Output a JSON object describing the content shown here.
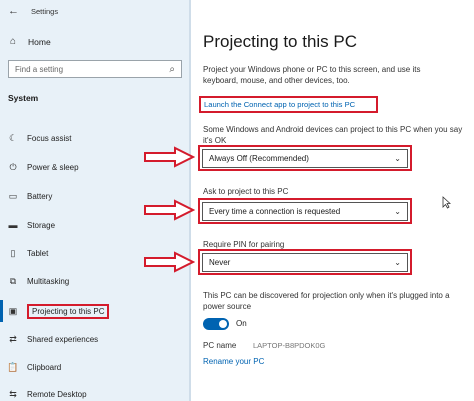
{
  "window": {
    "title": "Settings"
  },
  "sidebar": {
    "home": {
      "label": "Home",
      "icon": "home-icon"
    },
    "search": {
      "placeholder": "Find a setting",
      "icon": "search-icon"
    },
    "section": "System",
    "items": [
      {
        "label": "Focus assist",
        "icon": "moon-icon"
      },
      {
        "label": "Power & sleep",
        "icon": "power-icon"
      },
      {
        "label": "Battery",
        "icon": "battery-icon"
      },
      {
        "label": "Storage",
        "icon": "storage-icon"
      },
      {
        "label": "Tablet",
        "icon": "tablet-icon"
      },
      {
        "label": "Multitasking",
        "icon": "multitasking-icon"
      },
      {
        "label": "Projecting to this PC",
        "icon": "projector-icon",
        "active": true
      },
      {
        "label": "Shared experiences",
        "icon": "shared-icon"
      },
      {
        "label": "Clipboard",
        "icon": "clipboard-icon"
      },
      {
        "label": "Remote Desktop",
        "icon": "remote-icon"
      }
    ]
  },
  "main": {
    "title": "Projecting to this PC",
    "description": "Project your Windows phone or PC to this screen, and use its keyboard, mouse, and other devices, too.",
    "launch_link": "Launch the Connect app to project to this PC",
    "availability": {
      "label": "Some Windows and Android devices can project to this PC when you say it's OK",
      "value": "Always Off (Recommended)"
    },
    "ask": {
      "label": "Ask to project to this PC",
      "value": "Every time a connection is requested"
    },
    "pin": {
      "label": "Require PIN for pairing",
      "value": "Never"
    },
    "power": {
      "label": "This PC can be discovered for projection only when it's plugged into a power source",
      "toggle_state": "On"
    },
    "pc_name": {
      "label": "PC name",
      "value": "LAPTOP-B8PDOK0G"
    },
    "rename_link": "Rename your PC"
  },
  "colors": {
    "accent": "#0063b1",
    "highlight": "#d41b2c",
    "sidebar_bg": "#e8f1f8"
  }
}
